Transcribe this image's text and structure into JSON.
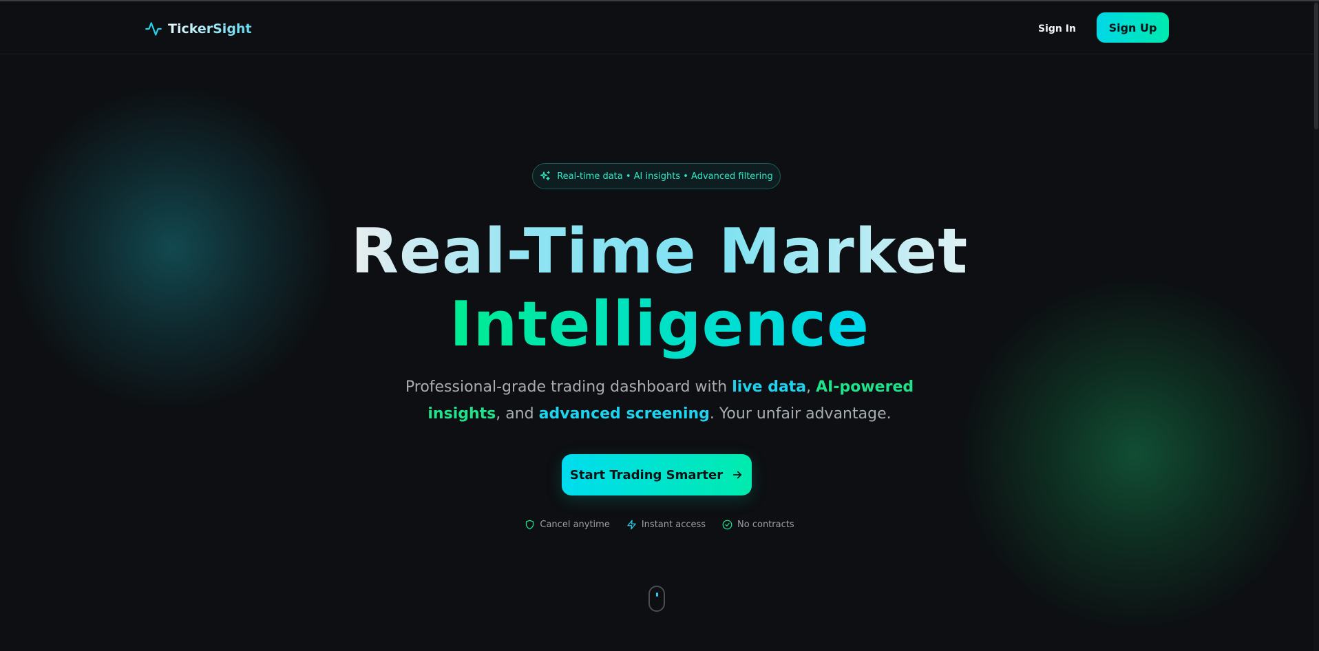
{
  "nav": {
    "brand": "TickerSight",
    "brand_icon": "activity-pulse-icon",
    "sign_in": "Sign In",
    "sign_up": "Sign Up"
  },
  "hero": {
    "badge": "Real-time data • AI insights • Advanced filtering",
    "badge_icon": "sparkles-icon",
    "title_line1": "Real-Time Market",
    "title_line2": "Intelligence",
    "subtitle": {
      "part1": "Professional-grade trading dashboard with ",
      "hl1": "live data",
      "sep1": ", ",
      "hl2": "AI-powered insights",
      "part2": ", and ",
      "hl3": "advanced screening",
      "part3": ". Your unfair advantage."
    },
    "cta": "Start Trading Smarter",
    "cta_icon": "arrow-right-icon",
    "features": [
      {
        "label": "Cancel anytime",
        "icon": "shield-icon"
      },
      {
        "label": "Instant access",
        "icon": "lightning-icon"
      },
      {
        "label": "No contracts",
        "icon": "check-circle-icon"
      }
    ]
  },
  "colors": {
    "background": "#0d0f12",
    "accent_cyan": "#00d8ee",
    "accent_green": "#00ec92"
  }
}
